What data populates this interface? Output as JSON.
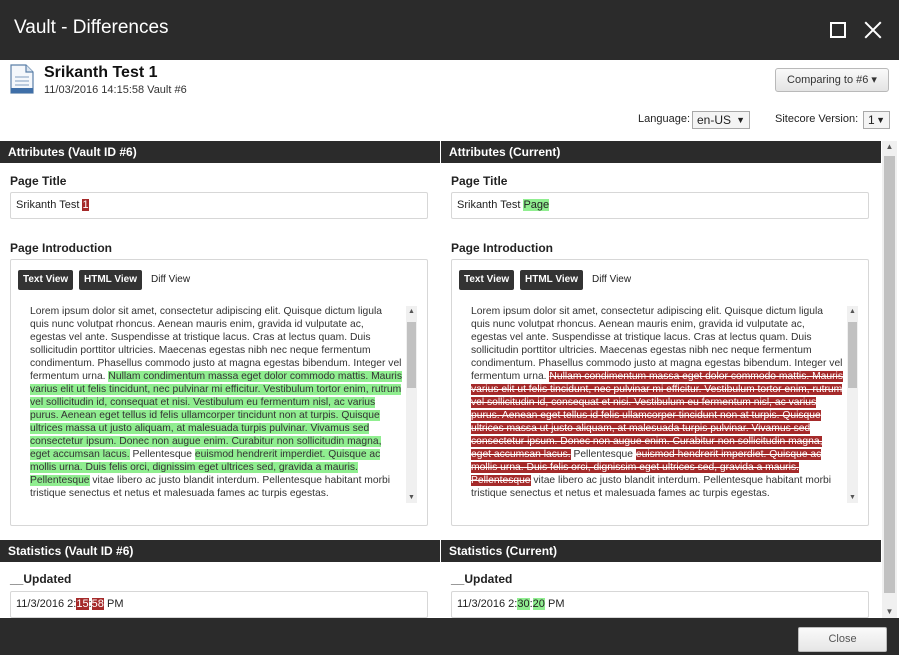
{
  "window": {
    "title": "Vault - Differences",
    "maximize_icon": "maximize-icon",
    "close_icon": "close-icon"
  },
  "header": {
    "item_title": "Srikanth Test 1",
    "item_subtitle": "11/03/2016 14:15:58 Vault #6",
    "compare_button": "Comparing to #6",
    "language_label": "Language:",
    "language_value": "en-US",
    "version_label": "Sitecore Version:",
    "version_value": "1"
  },
  "colors": {
    "titlebar": "#2b2b2b",
    "deleted_highlight": "#a52a2a",
    "inserted_highlight": "#90ee90"
  },
  "left": {
    "attributes_header": "Attributes (Vault ID #6)",
    "page_title_label": "Page Title",
    "page_title_plain": "Srikanth Test ",
    "page_title_diff": "1",
    "page_intro_label": "Page Introduction",
    "tabs": [
      "Text View",
      "HTML View",
      "Diff View"
    ],
    "intro_text_plain_1": "Lorem ipsum dolor sit amet, consectetur adipiscing elit. Quisque dictum ligula quis nunc volutpat rhoncus. Aenean mauris enim, gravida id vulputate ac, egestas vel ante. Suspendisse at tristique lacus. Cras at lectus quam. Duis sollicitudin porttitor ultricies. Maecenas egestas nibh nec neque fermentum condimentum. Phasellus commodo justo at magna egestas bibendum. Integer vel fermentum urna. ",
    "intro_text_diff_1": "Nullam condimentum massa eget dolor commodo mattis. Mauris varius elit ut felis tincidunt, nec pulvinar mi efficitur. Vestibulum tortor enim, rutrum vel sollicitudin id, consequat et nisi. Vestibulum eu fermentum nisl, ac varius purus. Aenean eget tellus id felis ullamcorper tincidunt non at turpis. Quisque ultrices massa ut justo aliquam, at malesuada turpis pulvinar. Vivamus sed consectetur ipsum. Donec non augue enim. Curabitur non sollicitudin magna, eget accumsan lacus.",
    "intro_text_plain_2": " Pellentesque ",
    "intro_text_diff_2": "euismod hendrerit imperdiet. Quisque ac mollis urna. Duis felis orci, dignissim eget ultrices sed, gravida a mauris. Pellentesque",
    "intro_text_plain_3": " vitae libero ac justo blandit interdum. Pellentesque habitant morbi tristique senectus et netus et malesuada fames ac turpis egestas.",
    "stats_header": "Statistics (Vault ID #6)",
    "updated_label": "__Updated",
    "updated_prefix": "11/3/2016 2:",
    "updated_diff_1": "15",
    "updated_sep": ":",
    "updated_diff_2": "58",
    "updated_suffix": " PM"
  },
  "right": {
    "attributes_header": "Attributes (Current)",
    "page_title_label": "Page Title",
    "page_title_plain": "Srikanth Test ",
    "page_title_diff": "Page",
    "page_intro_label": "Page Introduction",
    "tabs": [
      "Text View",
      "HTML View",
      "Diff View"
    ],
    "intro_text_plain_1": "Lorem ipsum dolor sit amet, consectetur adipiscing elit. Quisque dictum ligula quis nunc volutpat rhoncus. Aenean mauris enim, gravida id vulputate ac, egestas vel ante. Suspendisse at tristique lacus. Cras at lectus quam. Duis sollicitudin porttitor ultricies. Maecenas egestas nibh nec neque fermentum condimentum. Phasellus commodo justo at magna egestas bibendum. Integer vel fermentum urna. ",
    "intro_text_diff_1": "Nullam condimentum massa eget dolor commodo mattis. Mauris varius elit ut felis tincidunt, nec pulvinar mi efficitur. Vestibulum tortor enim, rutrum vel sollicitudin id, consequat et nisi. Vestibulum eu fermentum nisl, ac varius purus. Aenean eget tellus id felis ullamcorper tincidunt non at turpis. Quisque ultrices massa ut justo aliquam, at malesuada turpis pulvinar. Vivamus sed consectetur ipsum. Donec non augue enim. Curabitur non sollicitudin magna, eget accumsan lacus.",
    "intro_text_plain_2": " Pellentesque ",
    "intro_text_diff_2": "euismod hendrerit imperdiet. Quisque ac mollis urna. Duis felis orci, dignissim eget ultrices sed, gravida a mauris. Pellentesque",
    "intro_text_plain_3": " vitae libero ac justo blandit interdum. Pellentesque habitant morbi tristique senectus et netus et malesuada fames ac turpis egestas.",
    "stats_header": "Statistics (Current)",
    "updated_label": "__Updated",
    "updated_prefix": "11/3/2016 2:",
    "updated_diff_1": "30",
    "updated_sep": ":",
    "updated_diff_2": "20",
    "updated_suffix": " PM"
  },
  "footer": {
    "close_button": "Close"
  }
}
